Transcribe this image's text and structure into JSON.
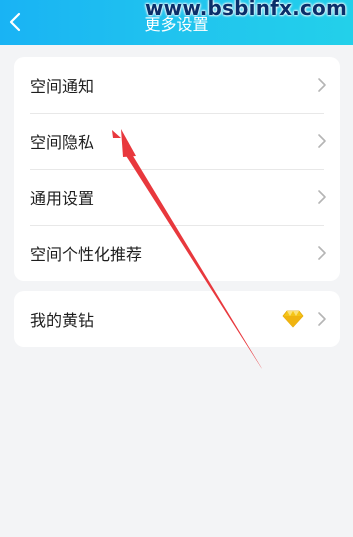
{
  "header": {
    "title": "更多设置",
    "back_icon": "chevron-left-icon"
  },
  "watermark": "www.bsbinfx.com",
  "settings_group": {
    "items": [
      {
        "label": "空间通知"
      },
      {
        "label": "空间隐私"
      },
      {
        "label": "通用设置"
      },
      {
        "label": "空间个性化推荐"
      }
    ]
  },
  "vip_group": {
    "items": [
      {
        "label": "我的黄钻",
        "icon": "yellow-diamond-icon"
      }
    ]
  },
  "colors": {
    "header_start": "#19b3f4",
    "header_end": "#23d0ea",
    "page_background": "#f3f4f6",
    "card_background": "#ffffff",
    "annotation_arrow": "#e8383d",
    "diamond": "#f5c518"
  }
}
